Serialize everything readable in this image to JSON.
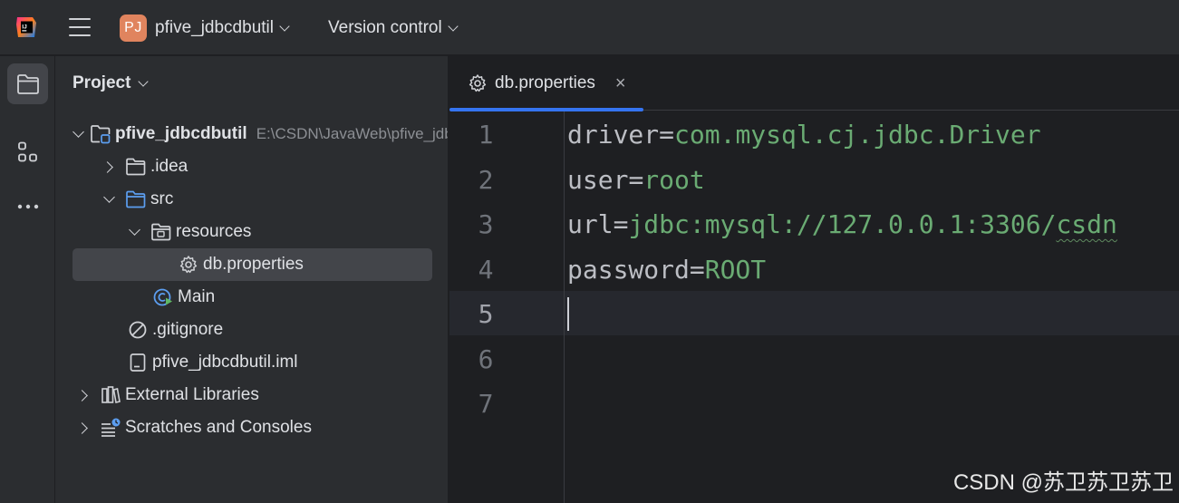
{
  "titlebar": {
    "project_badge": "PJ",
    "project_name": "pfive_jdbcdbutil",
    "version_control": "Version control"
  },
  "toolstrip": {
    "items": [
      "project-icon",
      "structure-icon",
      "more-icon"
    ]
  },
  "project_panel": {
    "title": "Project",
    "tree": [
      {
        "label": "pfive_jdbcdbutil",
        "hint": "E:\\CSDN\\JavaWeb\\pfive_jdbcdbutil",
        "expanded": true
      },
      {
        "label": ".idea",
        "expanded": false
      },
      {
        "label": "src",
        "expanded": true
      },
      {
        "label": "resources",
        "expanded": true
      },
      {
        "label": "db.properties",
        "selected": true
      },
      {
        "label": "Main"
      },
      {
        "label": ".gitignore"
      },
      {
        "label": "pfive_jdbcdbutil.iml"
      },
      {
        "label": "External Libraries",
        "expanded": false
      },
      {
        "label": "Scratches and Consoles",
        "expanded": false
      }
    ]
  },
  "editor": {
    "tab_label": "db.properties",
    "lines": [
      {
        "num": "1",
        "key": "driver",
        "eq": "=",
        "value": "com.mysql.cj.jdbc.Driver"
      },
      {
        "num": "2",
        "key": "user",
        "eq": "=",
        "value": "root"
      },
      {
        "num": "3",
        "key": "url",
        "eq": "=",
        "value_prefix": "jdbc:mysql://127.0.0.1:3306/",
        "value_typo": "csdn"
      },
      {
        "num": "4",
        "key": "password",
        "eq": "=",
        "value": "ROOT"
      },
      {
        "num": "5"
      },
      {
        "num": "6"
      },
      {
        "num": "7"
      }
    ],
    "current_line": "5"
  },
  "watermark": "CSDN @苏卫苏卫苏卫",
  "colors": {
    "accent": "#3574f0",
    "string_value": "#6aab73",
    "badge": "#e0845e"
  }
}
